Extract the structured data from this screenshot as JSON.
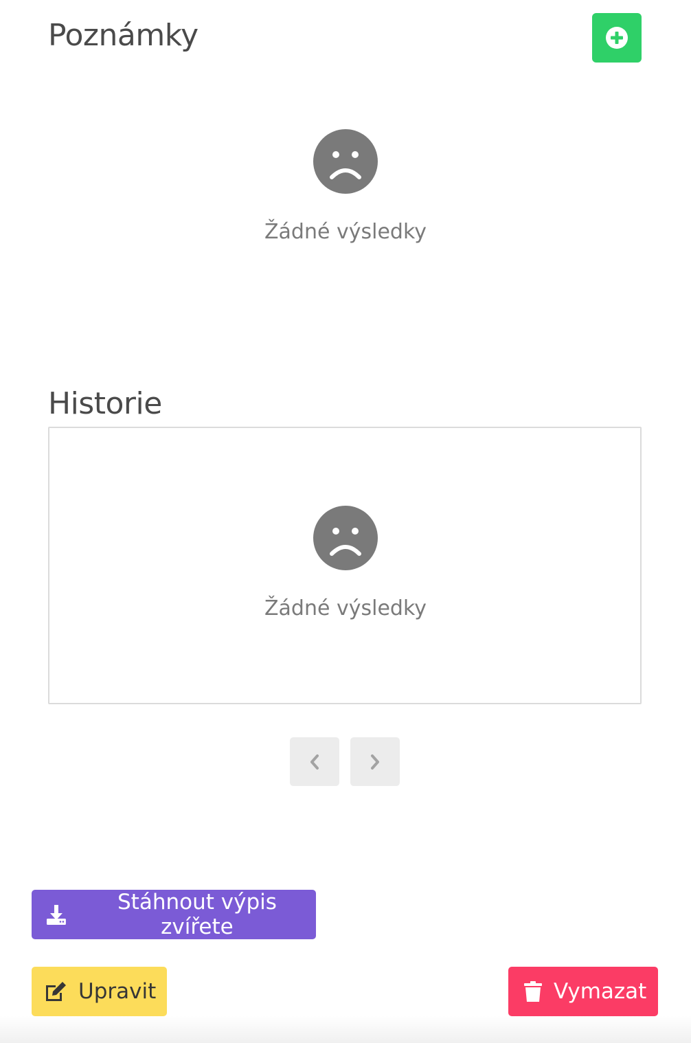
{
  "notes": {
    "title": "Poznámky",
    "add_icon": "plus-circle-icon",
    "empty_icon": "sad-face-icon",
    "empty_text": "Žádné výsledky"
  },
  "history": {
    "title": "Historie",
    "empty_icon": "sad-face-icon",
    "empty_text": "Žádné výsledky",
    "pagination": {
      "prev_icon": "chevron-left-icon",
      "next_icon": "chevron-right-icon"
    }
  },
  "actions": {
    "download_label": "Stáhnout výpis zvířete",
    "download_icon": "download-icon",
    "edit_label": "Upravit",
    "edit_icon": "edit-icon",
    "delete_label": "Vymazat",
    "delete_icon": "trash-icon"
  },
  "colors": {
    "add": "#2fd068",
    "download": "#7b5bd6",
    "edit": "#fcdc5a",
    "delete": "#fb3c65",
    "empty_icon": "#7a7a7a"
  }
}
